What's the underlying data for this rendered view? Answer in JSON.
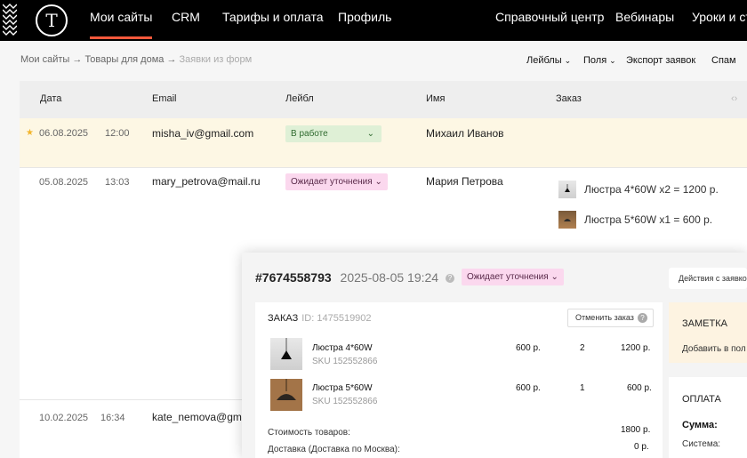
{
  "nav": {
    "logo": "T",
    "items": [
      {
        "label": "Мои сайты",
        "active": true
      },
      {
        "label": "CRM"
      },
      {
        "label": "Тарифы и оплата"
      },
      {
        "label": "Профиль"
      },
      {
        "label": "Справочный центр"
      },
      {
        "label": "Вебинары"
      },
      {
        "label": "Уроки и ст"
      }
    ]
  },
  "breadcrumb": {
    "items": [
      "Мои сайты",
      "Товары для дома",
      "Заявки из форм"
    ],
    "separator": "→"
  },
  "toolbar": {
    "labels": "Лейблы",
    "fields": "Поля",
    "export": "Экспорт заявок",
    "spam": "Спам"
  },
  "table": {
    "headers": [
      "Дата",
      "Email",
      "Лейбл",
      "Имя",
      "Заказ"
    ],
    "rows": [
      {
        "date": "06.08.2025",
        "time": "12:00",
        "email": "misha_iv@gmail.com",
        "label": "В работе",
        "name": "Михаил Иванов",
        "starred": true
      },
      {
        "date": "05.08.2025",
        "time": "13:03",
        "email": "mary_petrova@mail.ru",
        "label": "Ожидает уточнения",
        "name": "Мария Петрова",
        "order": [
          "Люстра 4*60W x2 = 1200 р.",
          "Люстра 5*60W x1 = 600 р."
        ]
      },
      {
        "date": "10.02.2025",
        "time": "16:34",
        "email": "kate_nemova@gmai"
      }
    ]
  },
  "modal": {
    "order_number": "#7674558793",
    "datetime": "2025-08-05 19:24",
    "status": "Ожидает уточнения",
    "actions_label": "Действия с заявкой",
    "order_card": {
      "title": "ЗАКАЗ",
      "id": "ID: 1475519902",
      "cancel_label": "Отменить заказ",
      "products": [
        {
          "name": "Люстра 4*60W",
          "sku": "SKU 152552866",
          "price": "600 р.",
          "qty": "2",
          "total": "1200 р."
        },
        {
          "name": "Люстра 5*60W",
          "sku": "SKU 152552866",
          "price": "600 р.",
          "qty": "1",
          "total": "600 р."
        }
      ],
      "subtotal_label": "Стоимость товаров:",
      "subtotal_value": "1800 р.",
      "delivery_label": "Доставка (Доставка по Москва):",
      "delivery_value": "0 р."
    },
    "note": {
      "title": "ЗАМЕТКА",
      "add": "Добавить в пол"
    },
    "payment": {
      "title": "ОПЛАТА",
      "sum_label": "Сумма:",
      "system_label": "Система:"
    }
  },
  "colors": {
    "nav_bg": "#000000",
    "nav_accent": "#f5583b",
    "label_green_bg": "#dff0d6",
    "label_pink_bg": "#fbd8ee",
    "highlight_row_bg": "#fdf7e4",
    "star": "#f2b52b"
  }
}
